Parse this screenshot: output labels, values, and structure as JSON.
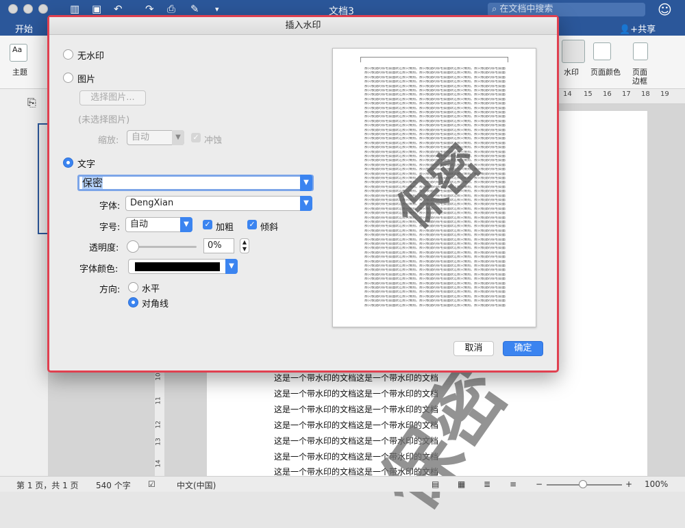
{
  "window": {
    "title": "文档3",
    "search_placeholder": "在文档中搜索"
  },
  "ribbon": {
    "tab": "开始",
    "share": "共享",
    "theme_label": "主题",
    "watermark_label": "水印",
    "page_color_label": "页面颜色",
    "page_border_label_1": "页面",
    "page_border_label_2": "边框",
    "ruler_ticks": [
      "14",
      "15",
      "16",
      "17",
      "18",
      "19"
    ]
  },
  "document": {
    "lines": [
      "这是一个带水印的文档这是一个带水印的文档",
      "这是一个带水印的文档这是一个带水印的文档",
      "这是一个带水印的文档这是一个带水印的文档",
      "这是一个带水印的文档这是一个带水印的文档",
      "这是一个带水印的文档这是一个带水印的文档",
      "这是一个带水印的文档这是一个带水印的文档",
      "这是一个带水印的文档这是一个带水印的文档"
    ],
    "vruler_ticks": [
      "10",
      "11",
      "12",
      "13",
      "14"
    ]
  },
  "statusbar": {
    "page": "第 1 页，共 1 页",
    "words": "540 个字",
    "lang": "中文(中国)",
    "zoom": "100%",
    "zoom_minus": "−",
    "zoom_plus": "+"
  },
  "dialog": {
    "title": "插入水印",
    "opt_none": "无水印",
    "opt_picture": "图片",
    "choose_picture": "选择图片...",
    "no_picture": "(未选择图片)",
    "scale_label": "缩放:",
    "scale_value": "自动",
    "washout_label": "冲蚀",
    "opt_text": "文字",
    "text_value": "保密",
    "font_label": "字体:",
    "font_value": "DengXian",
    "size_label": "字号:",
    "size_value": "自动",
    "bold_label": "加粗",
    "italic_label": "倾斜",
    "transparency_label": "透明度:",
    "transparency_value": "0%",
    "color_label": "字体颜色:",
    "font_color": "#000000",
    "orientation_label": "方向:",
    "orient_horizontal": "水平",
    "orient_diagonal": "对角线",
    "cancel": "取消",
    "ok": "确定",
    "selected_option": "text",
    "selected_orientation": "diagonal",
    "bold": true,
    "italic": true,
    "washout": true
  },
  "preview": {
    "text": "那只敏捷的棕毛狐狸跃过那只懒狗。那只敏捷的棕毛狐狸跃过那只懒狗。那只敏捷的棕毛狐狸跃过那只懒狗。",
    "watermark": "保密"
  },
  "watermark_bg": "保密",
  "colors": {
    "accent": "#3b84f0",
    "titlebar": "#2b579a",
    "highlight_border": "#e04050"
  }
}
